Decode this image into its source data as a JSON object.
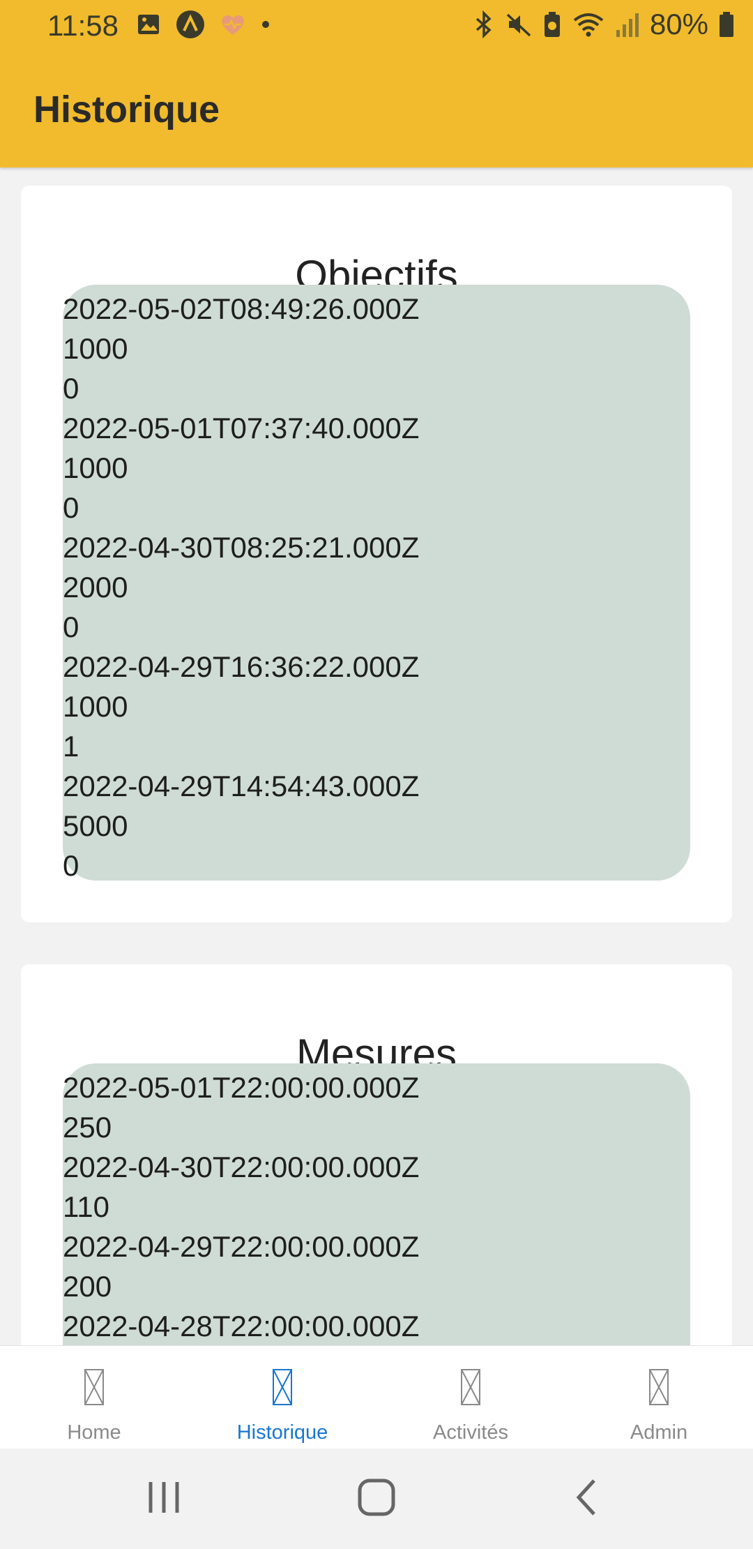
{
  "status_bar": {
    "time": "11:58",
    "battery_text": "80%",
    "left_icons": [
      "gallery-icon",
      "app-a-icon",
      "health-heart-icon",
      "dot-icon"
    ],
    "right_icons": [
      "bluetooth-icon",
      "mute-icon",
      "battery-saver-icon",
      "wifi-icon",
      "signal-icon",
      "battery-icon"
    ]
  },
  "header": {
    "title": "Historique",
    "background": "#F1BB2D"
  },
  "objectifs": {
    "title": "Objectifs",
    "lines": [
      "2022-05-02T08:49:26.000Z",
      "1000",
      "0",
      "2022-05-01T07:37:40.000Z",
      "1000",
      "0",
      "2022-04-30T08:25:21.000Z",
      "2000",
      "0",
      "2022-04-29T16:36:22.000Z",
      "1000",
      "1",
      "2022-04-29T14:54:43.000Z",
      "5000",
      "0"
    ]
  },
  "mesures": {
    "title": "Mesures",
    "lines": [
      "2022-05-01T22:00:00.000Z",
      "250",
      "2022-04-30T22:00:00.000Z",
      "110",
      "2022-04-29T22:00:00.000Z",
      "200",
      "2022-04-28T22:00:00.000Z"
    ]
  },
  "tabs": [
    {
      "label": "Home",
      "icon": "broken-image-icon",
      "active": false
    },
    {
      "label": "Historique",
      "icon": "broken-image-icon",
      "active": true
    },
    {
      "label": "Activités",
      "icon": "broken-image-icon",
      "active": false
    },
    {
      "label": "Admin",
      "icon": "broken-image-icon",
      "active": false
    }
  ],
  "colors": {
    "accent": "#1976D2",
    "data_box": "#CFDCD6",
    "inactive_tab": "#8a8a8a"
  }
}
